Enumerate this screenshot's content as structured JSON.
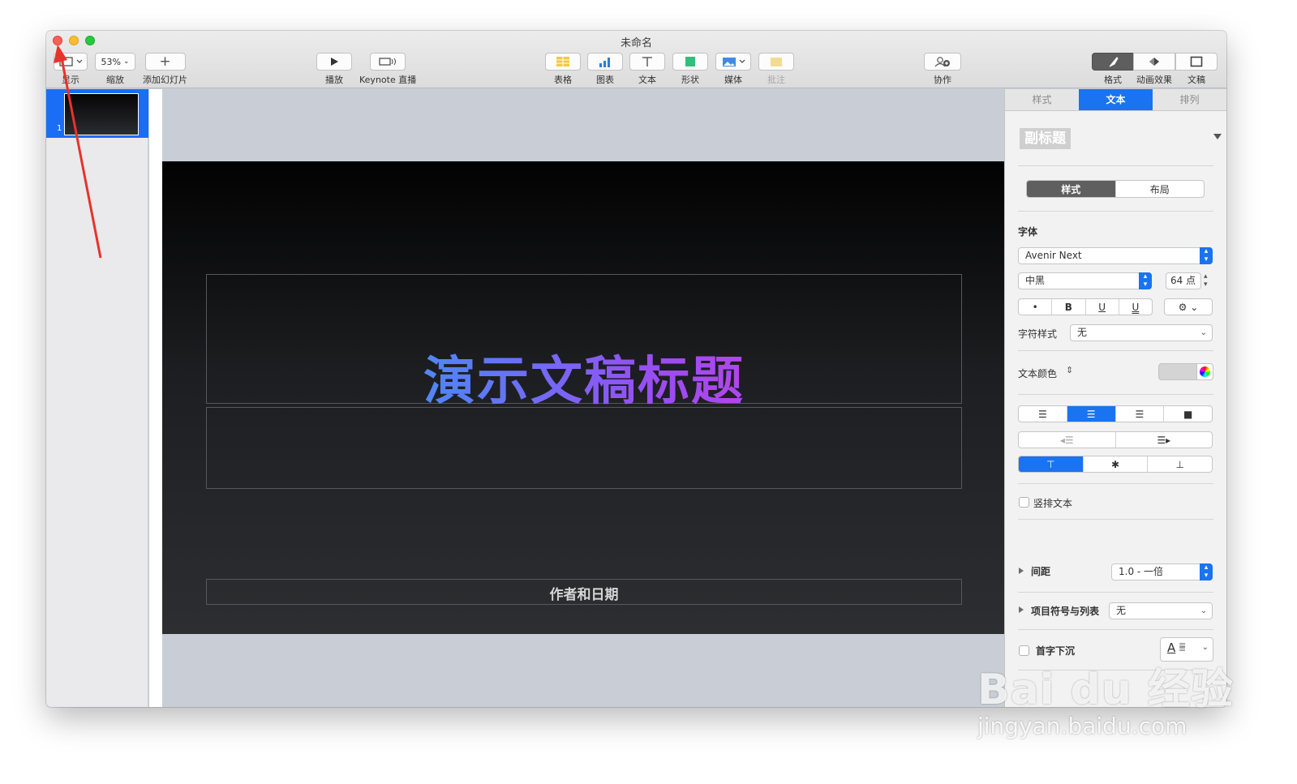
{
  "window": {
    "title": "未命名"
  },
  "toolbar": {
    "view_label": "显示",
    "zoom_value": "53%",
    "zoom_label": "缩放",
    "add_slide_label": "添加幻灯片",
    "play_label": "播放",
    "live_label": "Keynote 直播",
    "table_label": "表格",
    "chart_label": "图表",
    "text_label": "文本",
    "shape_label": "形状",
    "media_label": "媒体",
    "comment_label": "批注",
    "collab_label": "协作",
    "format_label": "格式",
    "animate_label": "动画效果",
    "document_label": "文稿"
  },
  "navigator": {
    "slides": [
      {
        "number": "1"
      }
    ]
  },
  "slide": {
    "title": "演示文稿标题",
    "subtitle": "作者和日期",
    "title_gradient": [
      "#21b8f7",
      "#e838d8"
    ]
  },
  "inspector": {
    "tabs": [
      "样式",
      "文本",
      "排列"
    ],
    "active_tab": "文本",
    "paragraph_style": "副标题",
    "sub_tabs": [
      "样式",
      "布局"
    ],
    "font_section": "字体",
    "font_family": "Avenir Next",
    "font_weight": "中黑",
    "font_size": "64 点",
    "style_buttons": [
      "•",
      "B",
      "U",
      "U"
    ],
    "char_style_label": "字符样式",
    "char_style_value": "无",
    "text_color_label": "文本颜色",
    "vertical_text_label": "竖排文本",
    "spacing_label": "间距",
    "spacing_value": "1.0 - 一倍",
    "bullets_label": "项目符号与列表",
    "bullets_value": "无",
    "dropcap_label": "首字下沉",
    "dropcap_sample": "A"
  },
  "watermark": {
    "brand": "Bai du 经验",
    "url": "jingyan.baidu.com"
  },
  "colors": {
    "accent": "#1a73f0",
    "annotation_arrow": "#e8322c"
  }
}
